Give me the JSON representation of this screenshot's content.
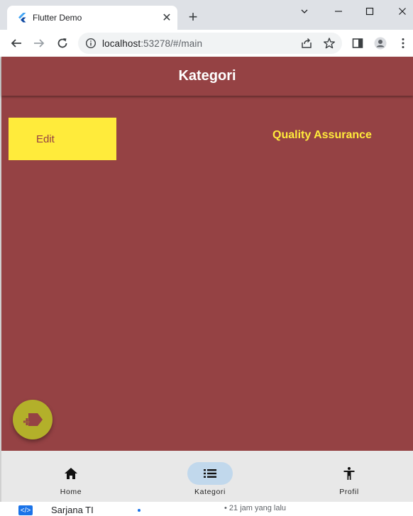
{
  "browser": {
    "tab_title": "Flutter Demo",
    "tab_close": "✕",
    "new_tab": "+",
    "url_host": "localhost",
    "url_rest": ":53278/#/main"
  },
  "app": {
    "title": "Kategori",
    "edit_label": "Edit",
    "category_name": "Quality Assurance"
  },
  "bottom_nav": {
    "items": [
      {
        "label": "Home",
        "icon": "home-icon"
      },
      {
        "label": "Kategori",
        "icon": "list-icon"
      },
      {
        "label": "Profil",
        "icon": "accessibility-icon"
      }
    ],
    "active_index": 1
  },
  "background": {
    "text": "Sarjana TI",
    "time": "• 21 jam yang lalu"
  },
  "colors": {
    "app_background": "#954244",
    "edit_button": "#ffeb3b",
    "fab": "#b3b02a",
    "nav_active": "#c1d8ec"
  }
}
